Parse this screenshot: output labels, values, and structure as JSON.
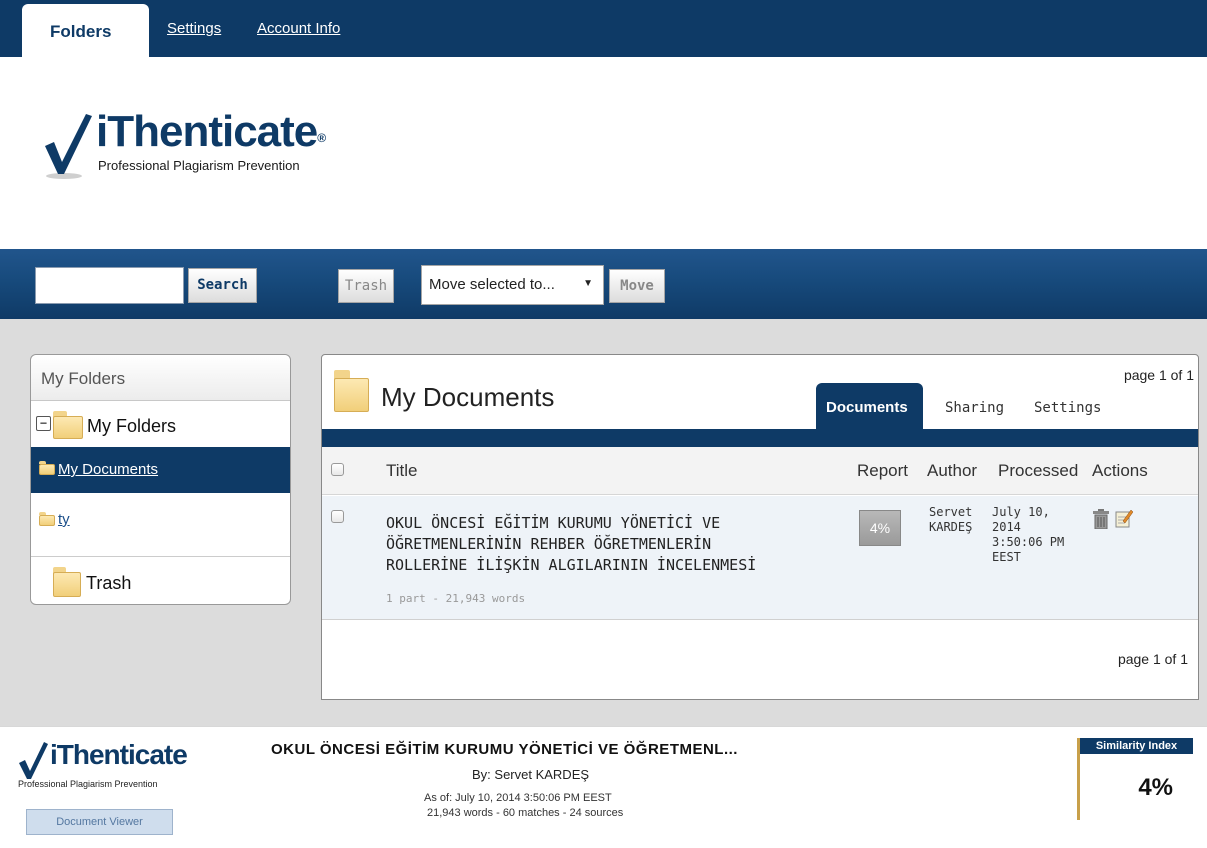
{
  "topnav": {
    "tabs": [
      "Folders",
      "Settings",
      "Account Info"
    ]
  },
  "logo": {
    "brand": "iThenticate",
    "reg": "®",
    "tagline": "Professional Plagiarism Prevention"
  },
  "toolbar": {
    "search_value": "",
    "search_label": "Search",
    "trash_label": "Trash",
    "move_select": "Move selected to...",
    "move_label": "Move"
  },
  "tree": {
    "header": "My Folders",
    "root": "My Folders",
    "toggle": "−",
    "items": [
      "My Documents",
      "ty"
    ],
    "trash": "Trash"
  },
  "docs": {
    "title": "My Documents",
    "pager": "page 1 of 1",
    "tabs": [
      "Documents",
      "Sharing",
      "Settings"
    ],
    "columns": [
      "Title",
      "Report",
      "Author",
      "Processed",
      "Actions"
    ],
    "rows": [
      {
        "title": "OKUL ÖNCESİ EĞİTİM KURUMU YÖNETİCİ VE ÖĞRETMENLERİNİN REHBER ÖĞRETMENLERİN ROLLERİNE İLİŞKİN ALGILARININ İNCELENMESİ",
        "meta": "1 part - 21,943 words",
        "report": "4%",
        "author_line1": "Servet",
        "author_line2": "KARDEŞ",
        "processed_line1": "July 10,",
        "processed_line2": "2014",
        "processed_line3": "3:50:06 PM",
        "processed_line4": "EEST"
      }
    ]
  },
  "viewer": {
    "brand": "iThenticate",
    "tagline": "Professional Plagiarism Prevention",
    "button": "Document Viewer",
    "title": "OKUL ÖNCESİ EĞİTİM KURUMU YÖNETİCİ VE ÖĞRETMENL...",
    "by": "By: Servet KARDEŞ",
    "line1": "As of: July 10, 2014 3:50:06 PM EEST",
    "line2": "21,943 words - 60 matches - 24 sources",
    "similarity_label": "Similarity Index",
    "similarity_value": "4%"
  },
  "colors": {
    "navy": "#0e3a66",
    "content_bg": "#dcdcdc",
    "folder": "#f1cf7a"
  }
}
